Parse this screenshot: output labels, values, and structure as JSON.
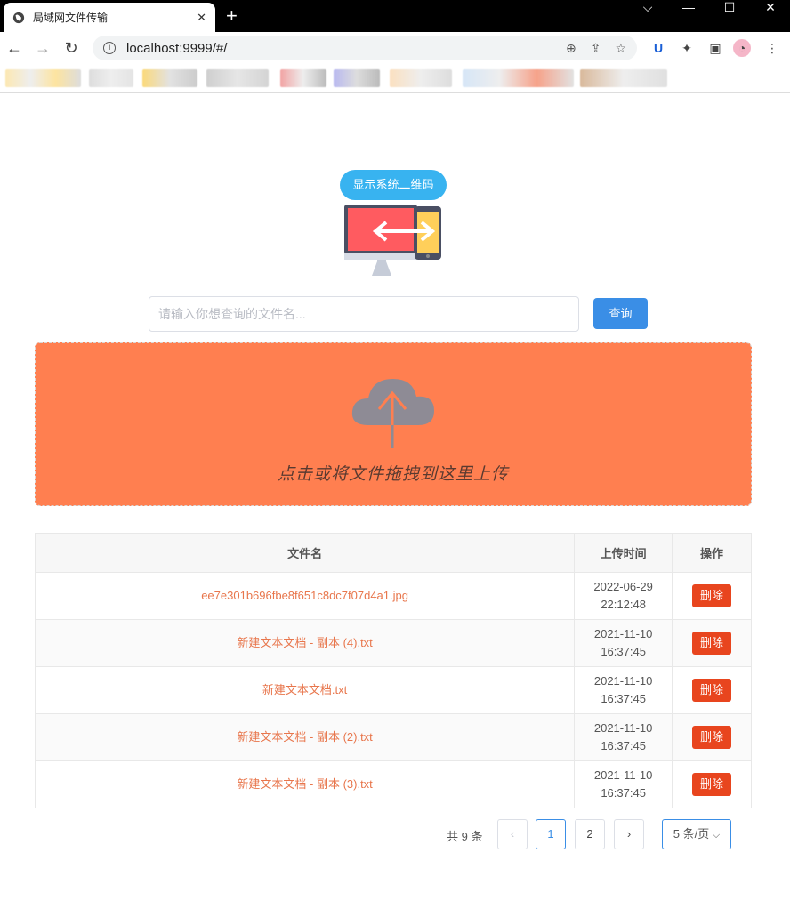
{
  "browser": {
    "tab_title": "局域网文件传输",
    "url": "localhost:9999/#/",
    "close_glyph": "✕",
    "newtab_glyph": "+"
  },
  "page": {
    "qr_button_label": "显示系统二维码",
    "search_placeholder": "请输入你想查询的文件名...",
    "search_value": "",
    "query_button_label": "查询",
    "upload_text": "点击或将文件拖拽到这里上传"
  },
  "table": {
    "headers": {
      "name": "文件名",
      "time": "上传时间",
      "op": "操作"
    },
    "rows": [
      {
        "name": "ee7e301b696fbe8f651c8dc7f07d4a1.jpg",
        "date": "2022-06-29",
        "time": "22:12:48",
        "action": "删除"
      },
      {
        "name": "新建文本文档 - 副本 (4).txt",
        "date": "2021-11-10",
        "time": "16:37:45",
        "action": "删除"
      },
      {
        "name": "新建文本文档.txt",
        "date": "2021-11-10",
        "time": "16:37:45",
        "action": "删除"
      },
      {
        "name": "新建文本文档 - 副本 (2).txt",
        "date": "2021-11-10",
        "time": "16:37:45",
        "action": "删除"
      },
      {
        "name": "新建文本文档 - 副本 (3).txt",
        "date": "2021-11-10",
        "time": "16:37:45",
        "action": "删除"
      }
    ]
  },
  "pagination": {
    "total_text": "共 9 条",
    "prev": "‹",
    "next": "›",
    "pages": [
      "1",
      "2"
    ],
    "current_page": "1",
    "page_size_label": "5 条/页"
  },
  "colors": {
    "upload_bg": "#ff7f50",
    "primary": "#3a8ee6",
    "qr_button": "#38b3f0",
    "delete": "#e8451e",
    "file_link": "#e8764c"
  }
}
